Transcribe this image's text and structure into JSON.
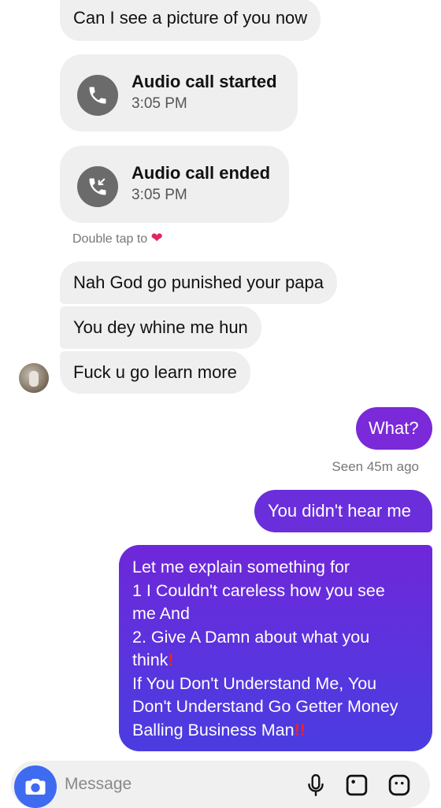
{
  "messages": {
    "incoming_top": "Can I see a picture of you now",
    "call_started": {
      "title": "Audio call started",
      "time": "3:05 PM"
    },
    "call_ended": {
      "title": "Audio call ended",
      "time": "3:05 PM"
    },
    "hint": "Double tap to",
    "incoming": [
      "Nah God go punished your papa",
      "You dey whine me hun",
      "Fuck u go learn more"
    ],
    "outgoing_what": "What?",
    "seen": "Seen 45m ago",
    "outgoing_hear": "You didn't hear me",
    "long_lines": [
      "Let me explain something for",
      "1 I Couldn't careless how you see",
      "me And",
      "2. Give A Damn about what you",
      "think",
      "If You Don't Understand Me, You",
      "Don't Understand Go Getter Money",
      "Balling Business Man"
    ]
  },
  "composer": {
    "placeholder": "Message"
  },
  "icons": {
    "heart": "heart-icon",
    "phone": "phone-icon",
    "missed_call": "call-ended-icon",
    "camera": "camera-icon",
    "mic": "mic-icon",
    "gallery": "gallery-icon",
    "sticker": "sticker-icon",
    "exclamation": "double-exclamation-icon"
  },
  "colors": {
    "incoming_bubble": "#efefef",
    "outgoing_top": "#6f27d9",
    "outgoing_bottom": "#4a3ce0",
    "camera_button": "#3e6bf0"
  }
}
